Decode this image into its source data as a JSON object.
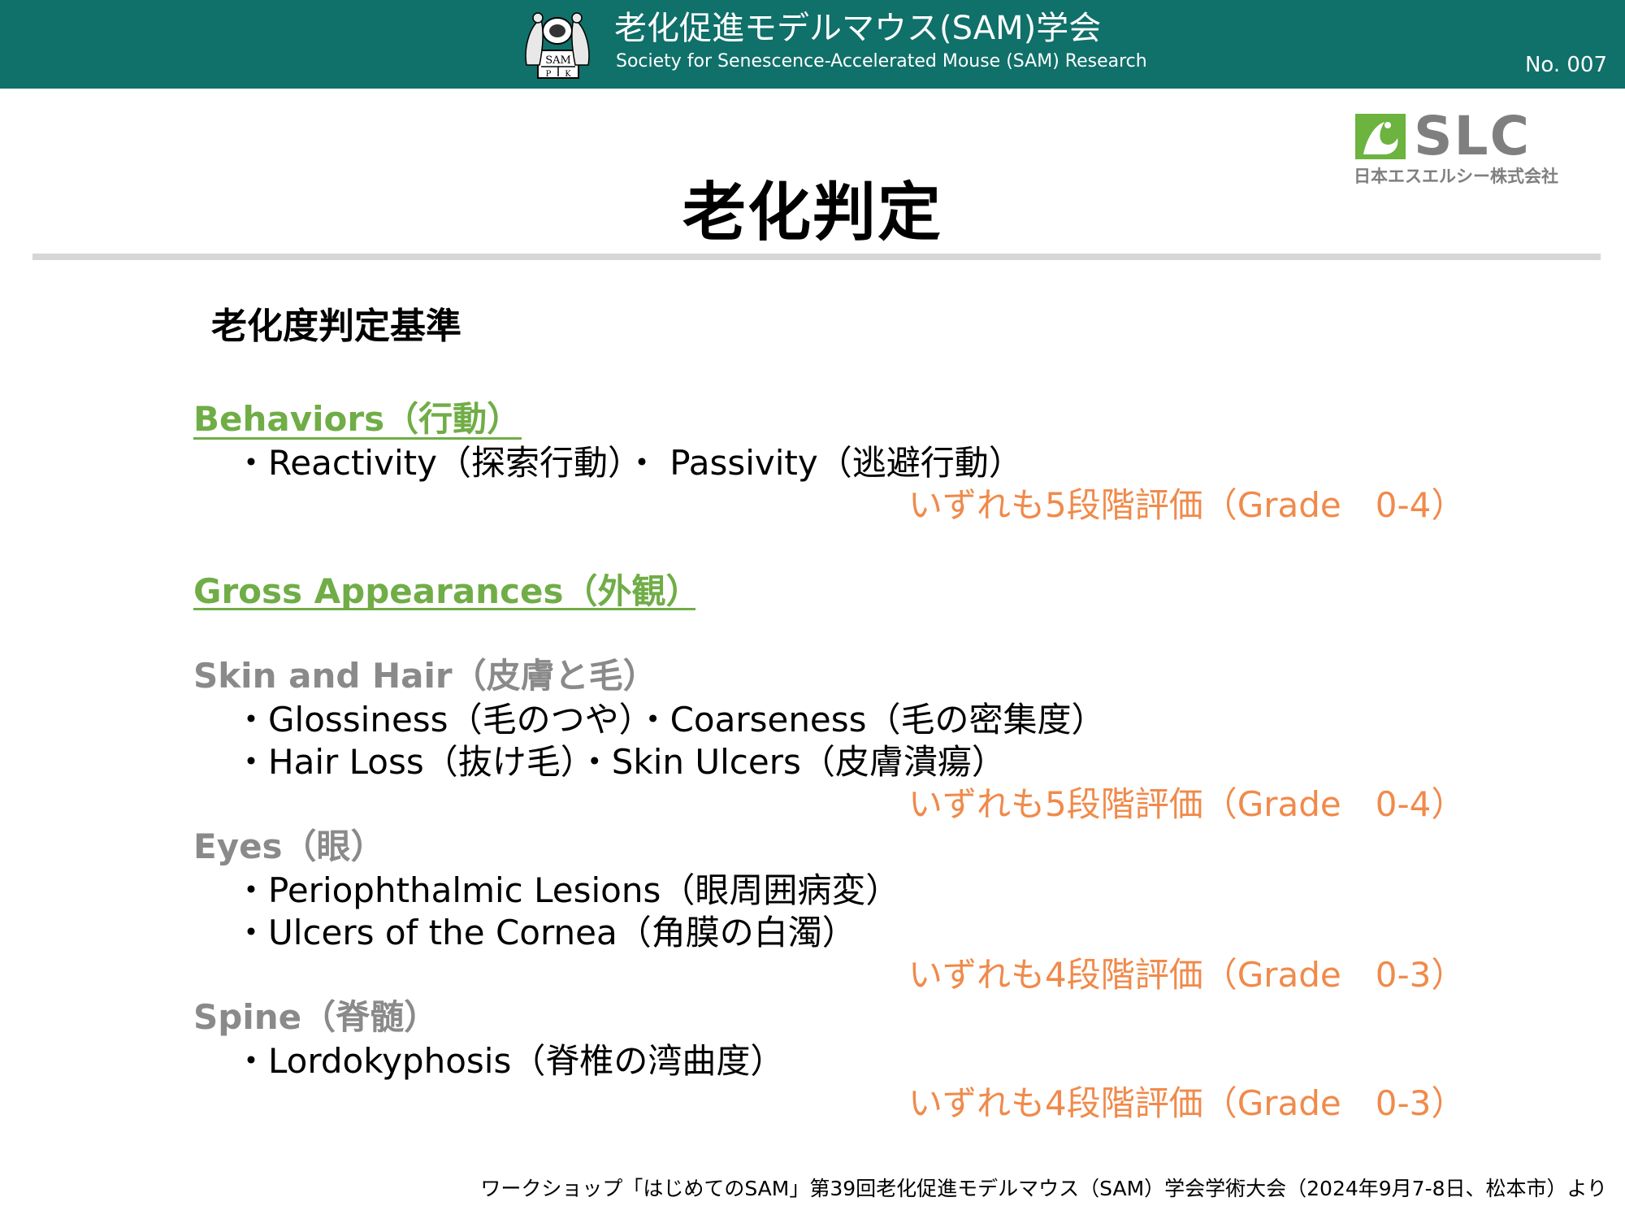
{
  "header": {
    "org_name_ja": "老化促進モデルマウス(SAM)学会",
    "org_name_en": "Society for Senescence-Accelerated Mouse (SAM) Research",
    "logo_text_top": "SAM",
    "logo_text_left": "P",
    "logo_text_right": "K",
    "doc_number": "No. 007",
    "bg_color": "#10706a"
  },
  "sponsor": {
    "logo_text": "SLC",
    "company_name": "日本エスエルシー株式会社"
  },
  "title": "老化判定",
  "subtitle": "老化度判定基準",
  "sections": {
    "behaviors": {
      "heading": "Behaviors（行動）",
      "items": "・Reactivity（探索行動）・ Passivity（逃避行動）",
      "grade": "いずれも5段階評価（Grade　0-4）"
    },
    "gross": {
      "heading": "Gross Appearances（外観）"
    },
    "skin": {
      "heading": "Skin and Hair（皮膚と毛）",
      "item1": "・Glossiness（毛のつや）・Coarseness（毛の密集度）",
      "item2": "・Hair Loss（抜け毛）・Skin Ulcers（皮膚潰瘍）",
      "grade": "いずれも5段階評価（Grade　0-4）"
    },
    "eyes": {
      "heading": "Eyes（眼）",
      "item1": "・Periophthalmic Lesions（眼周囲病変）",
      "item2": "・Ulcers of the Cornea（角膜の白濁）",
      "grade": "いずれも4段階評価（Grade　0-3）"
    },
    "spine": {
      "heading": "Spine（脊髄）",
      "item1": "・Lordokyphosis（脊椎の湾曲度）",
      "grade": "いずれも4段階評価（Grade　0-3）"
    }
  },
  "footer": "ワークショップ「はじめてのSAM」第39回老化促進モデルマウス（SAM）学会学術大会（2024年9月7-8日、松本市）より",
  "colors": {
    "heading_green": "#70ad47",
    "subheading_gray": "#8a8a8a",
    "grade_orange": "#f08a4b"
  }
}
